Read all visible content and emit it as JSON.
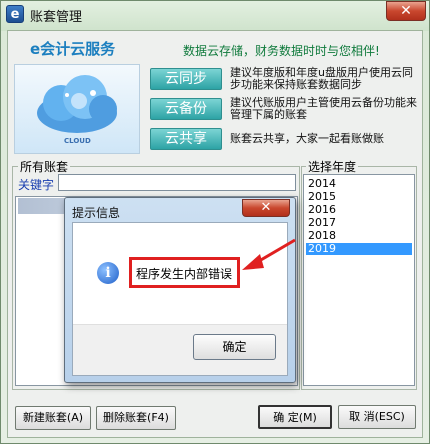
{
  "window": {
    "title": "账套管理",
    "close_glyph": "✕"
  },
  "banner": {
    "brand": "e会计云服务",
    "tagline": "数据云存储，财务数据时时与您相伴!",
    "cloud_label": "CLOUD",
    "features": [
      {
        "label": "云同步",
        "desc": "建议年度版和年度u盘版用户使用云同步功能来保持账套数据同步"
      },
      {
        "label": "云备份",
        "desc": "建议代账版用户主管使用云备份功能来管理下属的账套"
      },
      {
        "label": "云共享",
        "desc": "账套云共享，大家一起看账做账"
      }
    ]
  },
  "accounts": {
    "group_label": "所有账套",
    "keyword_label": "关键字",
    "keyword_value": ""
  },
  "years": {
    "group_label": "选择年度",
    "items": [
      "2014",
      "2015",
      "2016",
      "2017",
      "2018",
      "2019"
    ],
    "selected": "2019"
  },
  "buttons": {
    "new": "新建账套(A)",
    "delete": "删除账套(F4)",
    "ok": "确 定(M)",
    "cancel": "取 消(ESC)"
  },
  "dialog": {
    "title": "提示信息",
    "close_glyph": "✕",
    "message": "程序发生内部错误",
    "ok": "确定",
    "icon": "info-icon"
  },
  "colors": {
    "annotation": "#e02020",
    "selection": "#3399ff"
  }
}
